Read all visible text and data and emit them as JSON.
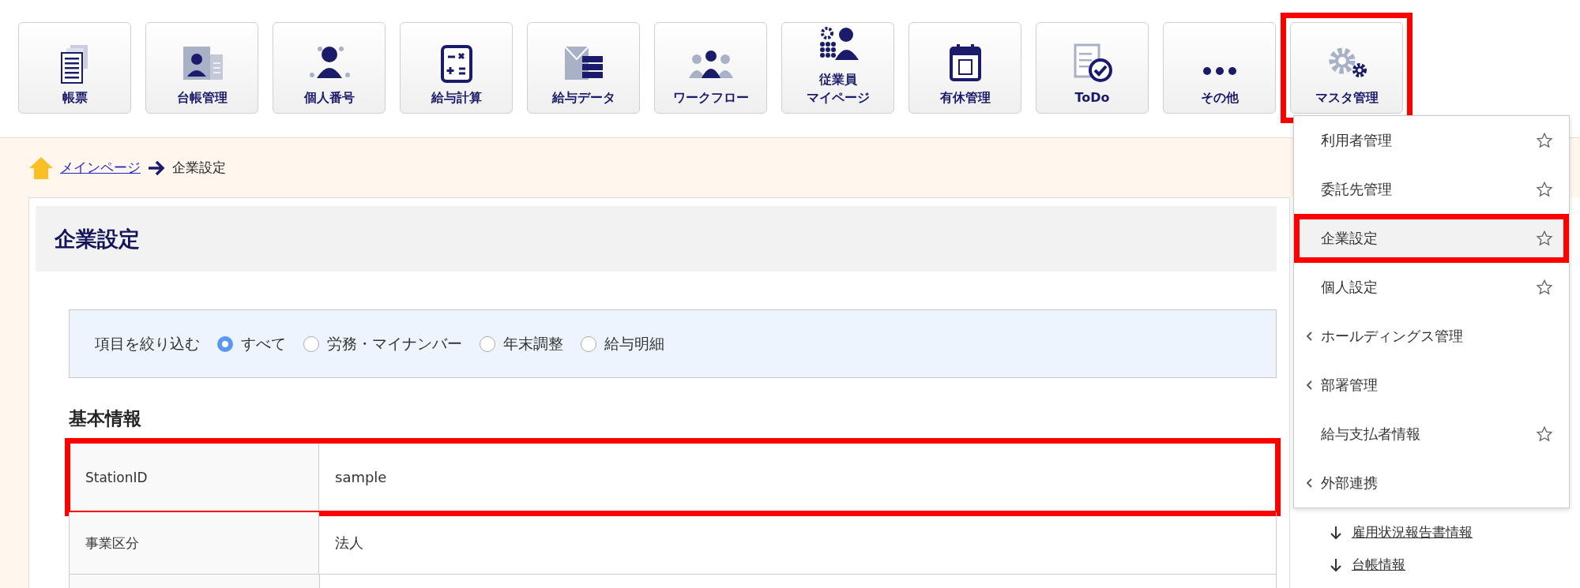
{
  "toolbar": [
    {
      "label": "帳票",
      "highlighted": false
    },
    {
      "label": "台帳管理",
      "highlighted": false
    },
    {
      "label": "個人番号",
      "highlighted": false
    },
    {
      "label": "給与計算",
      "highlighted": false
    },
    {
      "label": "給与データ",
      "highlighted": false
    },
    {
      "label": "ワークフロー",
      "highlighted": false
    },
    {
      "label": [
        "従業員",
        "マイページ"
      ],
      "highlighted": false
    },
    {
      "label": "有休管理",
      "highlighted": false
    },
    {
      "label": "ToDo",
      "highlighted": false
    },
    {
      "label": "その他",
      "highlighted": false
    },
    {
      "label": "マスタ管理",
      "highlighted": true
    }
  ],
  "breadcrumb": {
    "home_link": "メインページ",
    "current": "企業設定"
  },
  "page_title": "企業設定",
  "filter": {
    "label": "項目を絞り込む",
    "options": [
      {
        "label": "すべて",
        "selected": true
      },
      {
        "label": "労務・マイナンバー",
        "selected": false
      },
      {
        "label": "年末調整",
        "selected": false
      },
      {
        "label": "給与明細",
        "selected": false
      }
    ]
  },
  "section_title": "基本情報",
  "table": {
    "rows": [
      {
        "label": "StationID",
        "value": "sample",
        "highlighted": true
      },
      {
        "label": "事業区分",
        "value": "法人",
        "highlighted": false
      }
    ]
  },
  "side_links": [
    "雇用状況報告書情報",
    "台帳情報"
  ],
  "dropdown": {
    "items": [
      {
        "label": "利用者管理",
        "kind": "favorite",
        "selected": false,
        "highlighted": false
      },
      {
        "label": "委託先管理",
        "kind": "favorite",
        "selected": false,
        "highlighted": false
      },
      {
        "label": "企業設定",
        "kind": "favorite",
        "selected": true,
        "highlighted": true
      },
      {
        "label": "個人設定",
        "kind": "favorite",
        "selected": false,
        "highlighted": false
      },
      {
        "label": "ホールディングス管理",
        "kind": "submenu",
        "selected": false,
        "highlighted": false
      },
      {
        "label": "部署管理",
        "kind": "submenu",
        "selected": false,
        "highlighted": false
      },
      {
        "label": "給与支払者情報",
        "kind": "favorite",
        "selected": false,
        "highlighted": false
      },
      {
        "label": "外部連携",
        "kind": "submenu",
        "selected": false,
        "highlighted": false
      }
    ]
  }
}
